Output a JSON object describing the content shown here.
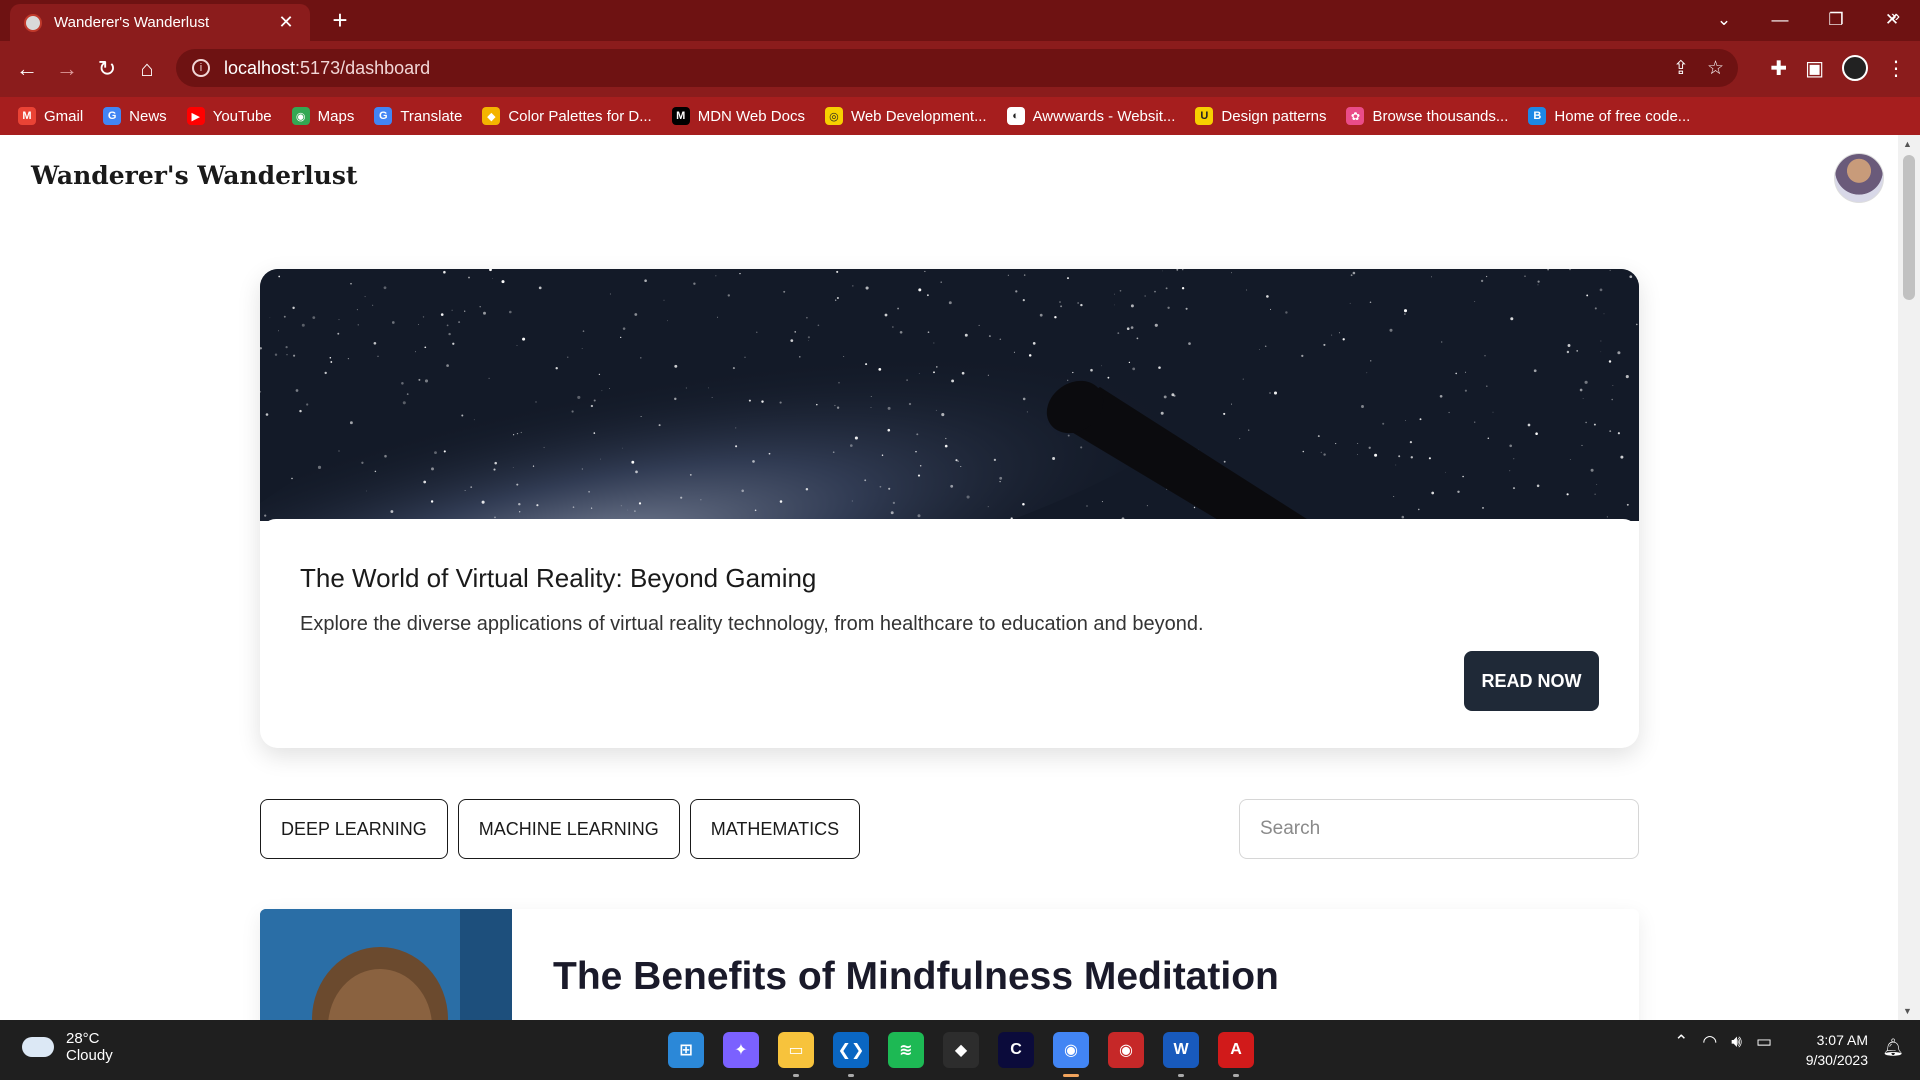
{
  "browser": {
    "tab_title": "Wanderer's Wanderlust",
    "tab_close": "✕",
    "new_tab": "+",
    "url_host": "localhost",
    "url_path": ":5173/dashboard",
    "bookmarks": [
      {
        "label": "Gmail",
        "color": "#ea4335",
        "glyph": "M"
      },
      {
        "label": "News",
        "color": "#4285f4",
        "glyph": "G"
      },
      {
        "label": "YouTube",
        "color": "#ff0000",
        "glyph": "▶"
      },
      {
        "label": "Maps",
        "color": "#34a853",
        "glyph": "◉"
      },
      {
        "label": "Translate",
        "color": "#4285f4",
        "glyph": "G"
      },
      {
        "label": "Color Palettes for D...",
        "color": "#f4b400",
        "glyph": "◆"
      },
      {
        "label": "MDN Web Docs",
        "color": "#000000",
        "glyph": "M"
      },
      {
        "label": "Web Development...",
        "color": "#f7d000",
        "glyph": "◎"
      },
      {
        "label": "Awwwards - Websit...",
        "color": "#ffffff",
        "glyph": "◐"
      },
      {
        "label": "Design patterns",
        "color": "#f7d000",
        "glyph": "U"
      },
      {
        "label": "Browse thousands...",
        "color": "#ea4c89",
        "glyph": "✿"
      },
      {
        "label": "Home of free code...",
        "color": "#1e88e5",
        "glyph": "B"
      }
    ],
    "bookmarks_more": "»"
  },
  "page": {
    "brand": "Wanderer's Wanderlust",
    "hero": {
      "title": "The World of Virtual Reality: Beyond Gaming",
      "description": "Explore the diverse applications of virtual reality technology, from healthcare to education and beyond.",
      "button": "READ NOW"
    },
    "categories": [
      "DEEP LEARNING",
      "MACHINE LEARNING",
      "MATHEMATICS"
    ],
    "search": {
      "placeholder": "Search",
      "value": ""
    },
    "second_card": {
      "title": "The Benefits of Mindfulness Meditation"
    }
  },
  "taskbar": {
    "weather_temp": "28°C",
    "weather_desc": "Cloudy",
    "apps": [
      {
        "name": "start",
        "color": "#2b88d8",
        "glyph": "⊞",
        "state": ""
      },
      {
        "name": "copilot",
        "color": "#7b61ff",
        "glyph": "✦",
        "state": ""
      },
      {
        "name": "file-explorer",
        "color": "#f7c33c",
        "glyph": "▭",
        "state": "open"
      },
      {
        "name": "vscode",
        "color": "#0a66c2",
        "glyph": "❮❯",
        "state": "open"
      },
      {
        "name": "spotify",
        "color": "#1db954",
        "glyph": "≋",
        "state": ""
      },
      {
        "name": "git",
        "color": "#2d2d2d",
        "glyph": "◆",
        "state": ""
      },
      {
        "name": "c-app",
        "color": "#0b0b3b",
        "glyph": "C",
        "state": ""
      },
      {
        "name": "chrome",
        "color": "#4285f4",
        "glyph": "◉",
        "state": "active"
      },
      {
        "name": "record",
        "color": "#c62828",
        "glyph": "◉",
        "state": ""
      },
      {
        "name": "word",
        "color": "#185abd",
        "glyph": "W",
        "state": "open"
      },
      {
        "name": "acrobat",
        "color": "#d11a1a",
        "glyph": "A",
        "state": "open"
      }
    ],
    "time": "3:07 AM",
    "date": "9/30/2023"
  }
}
